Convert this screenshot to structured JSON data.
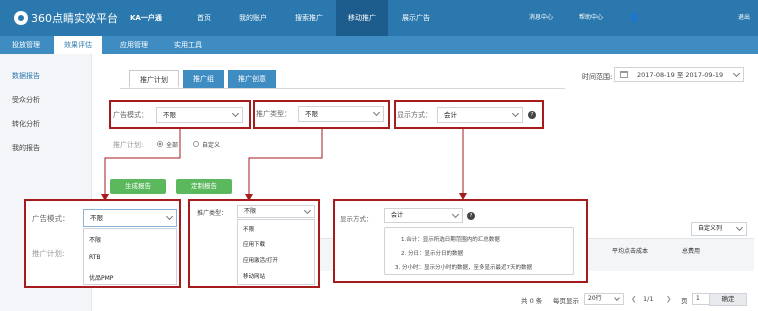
{
  "header": {
    "logo_text": "360点睛实效平台",
    "account": "KA一户通",
    "nav": [
      "首页",
      "我的账户",
      "搜索推广",
      "移动推广",
      "展示广告"
    ],
    "right": [
      "消息中心",
      "帮助中心",
      "退出"
    ],
    "user_icon": "user-icon"
  },
  "subnav": [
    "投放管理",
    "效果评估",
    "应用管理",
    "实用工具"
  ],
  "sidebar": [
    "数据报告",
    "受众分析",
    "转化分析",
    "我的报告"
  ],
  "tabs": [
    "推广计划",
    "推广组",
    "推广创意"
  ],
  "time_range": {
    "label": "时间范围:",
    "value": "2017-08-19 至 2017-09-19"
  },
  "filters": {
    "ad_mode_label": "广告模式：",
    "ad_mode_value": "不限",
    "promo_type_label": "推广类型：",
    "promo_type_value": "不限",
    "display_label": "显示方式：",
    "display_value": "会计"
  },
  "plan": {
    "label": "推广计划:",
    "opt_all": "全部",
    "opt_custom": "自定义"
  },
  "buttons": {
    "gen_report": "生成报告",
    "custom_report": "定制报告"
  },
  "popup_ad": {
    "label": "广告模式：",
    "value": "不限",
    "plan_label": "推广计划:",
    "options": [
      "不限",
      "RTB",
      "优品PMP"
    ]
  },
  "popup_type": {
    "label": "推广类型：",
    "value": "不限",
    "options": [
      "不限",
      "应用下载",
      "应用激活/打开",
      "移动网站"
    ]
  },
  "popup_display": {
    "label": "显示方式：",
    "value": "会计",
    "tips": [
      "1.合计：显示所选日期范围内的汇总数据",
      "2. 分日：显示分日的数据",
      "3. 分小时：显示分小时的数据，至多显示最近7天的数据"
    ]
  },
  "table": {
    "custom_cols": "自定义列",
    "headers": [
      "平均点击成本",
      "总费用"
    ]
  },
  "pagination": {
    "total": "共 0 条",
    "per_page_label": "每页显示",
    "per_page": "20行",
    "page_info": "1/1",
    "page_label": "页",
    "page_value": "1",
    "confirm": "确定"
  }
}
